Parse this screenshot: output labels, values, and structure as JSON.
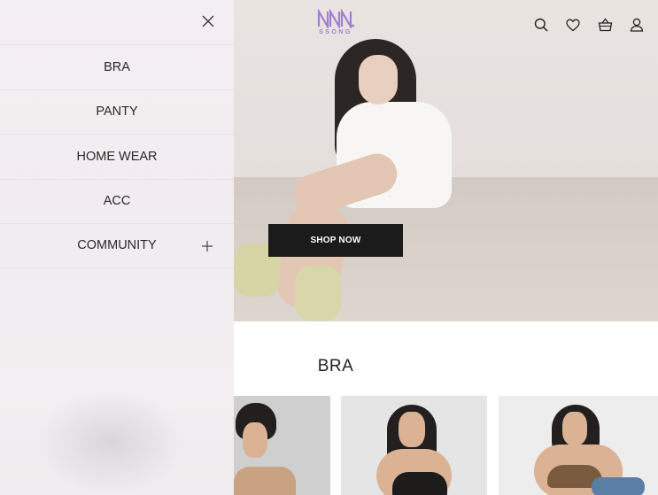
{
  "header": {
    "logo_text": "SSONG",
    "icons": [
      "search-icon",
      "heart-icon",
      "basket-icon",
      "user-icon"
    ]
  },
  "hero": {
    "cta_label": "SHOP NOW"
  },
  "section": {
    "title": "BRA"
  },
  "drawer": {
    "close_icon": "close-icon",
    "items": [
      {
        "label": "BRA"
      },
      {
        "label": "PANTY"
      },
      {
        "label": "HOME WEAR"
      },
      {
        "label": "ACC"
      },
      {
        "label": "COMMUNITY",
        "expand_icon": "plus-icon"
      }
    ]
  },
  "colors": {
    "brand_purple": "#a17fd3",
    "cta_background": "#1b1b1b",
    "drawer_background": "#f3eef1"
  }
}
